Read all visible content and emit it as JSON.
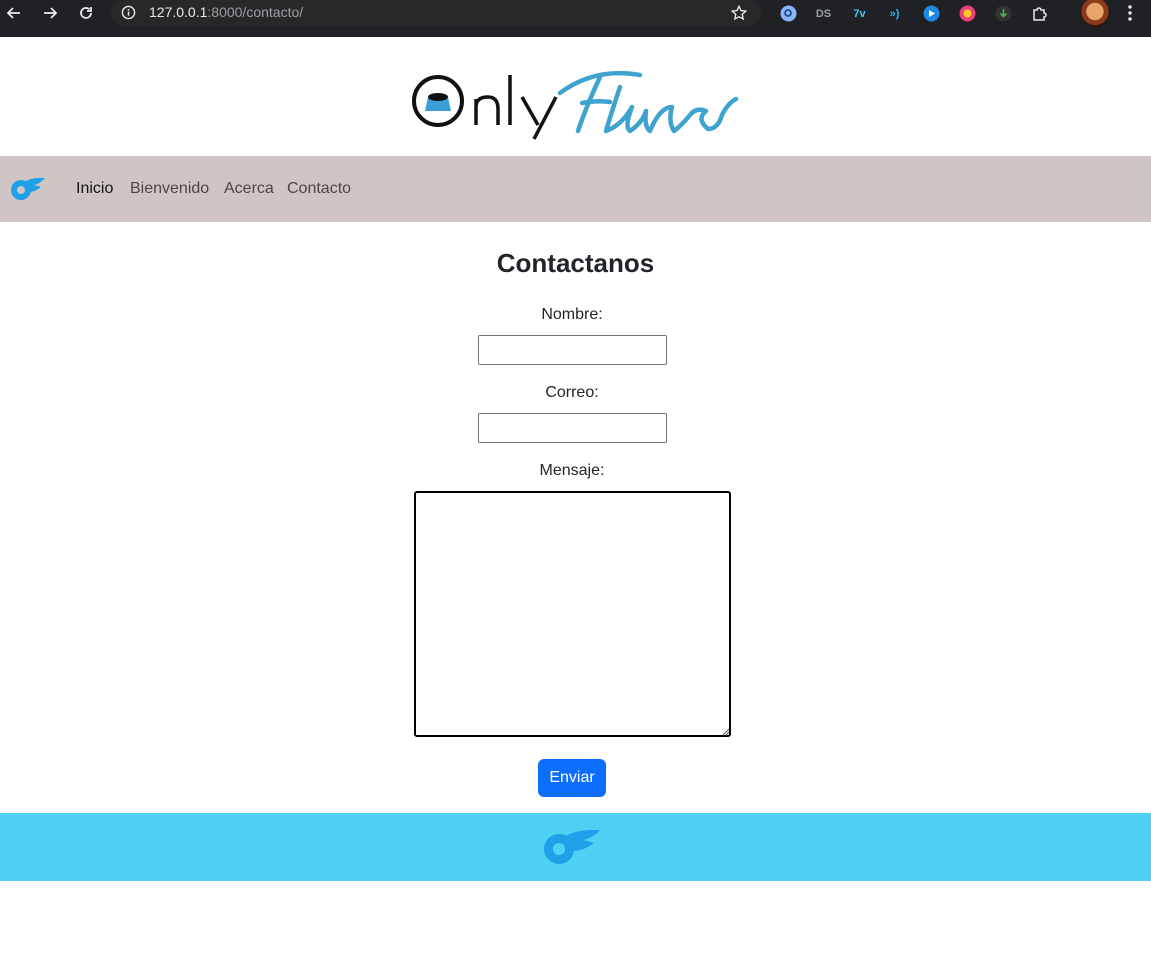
{
  "browser": {
    "url_host": "127.0.0.1",
    "url_path": ":8000/contacto/",
    "extensions": [
      "search-extension-icon",
      "ds-extension-icon",
      "translate-extension-icon",
      "wifi-extension-icon",
      "player-extension-icon",
      "color-extension-icon",
      "download-extension-icon",
      "puzzle-extension-icon"
    ]
  },
  "header": {
    "logo_only": "Only",
    "logo_flans": "Flans"
  },
  "navbar": {
    "items": [
      {
        "label": "Inicio",
        "active": true
      },
      {
        "label": "Bienvenido",
        "active": false
      },
      {
        "label": "Acerca",
        "active": false
      },
      {
        "label": "Contacto",
        "active": false
      }
    ]
  },
  "form": {
    "title": "Contactanos",
    "name_label": "Nombre:",
    "name_value": "",
    "email_label": "Correo:",
    "email_value": "",
    "message_label": "Mensaje:",
    "message_value": "",
    "submit_label": "Enviar"
  },
  "colors": {
    "navbar_bg": "#d0c5c5",
    "footer_bg": "#4fd1f4",
    "button_bg": "#0d6efd",
    "brand_blue": "#1ea1e8",
    "flans_blue": "#3ea3cf"
  }
}
